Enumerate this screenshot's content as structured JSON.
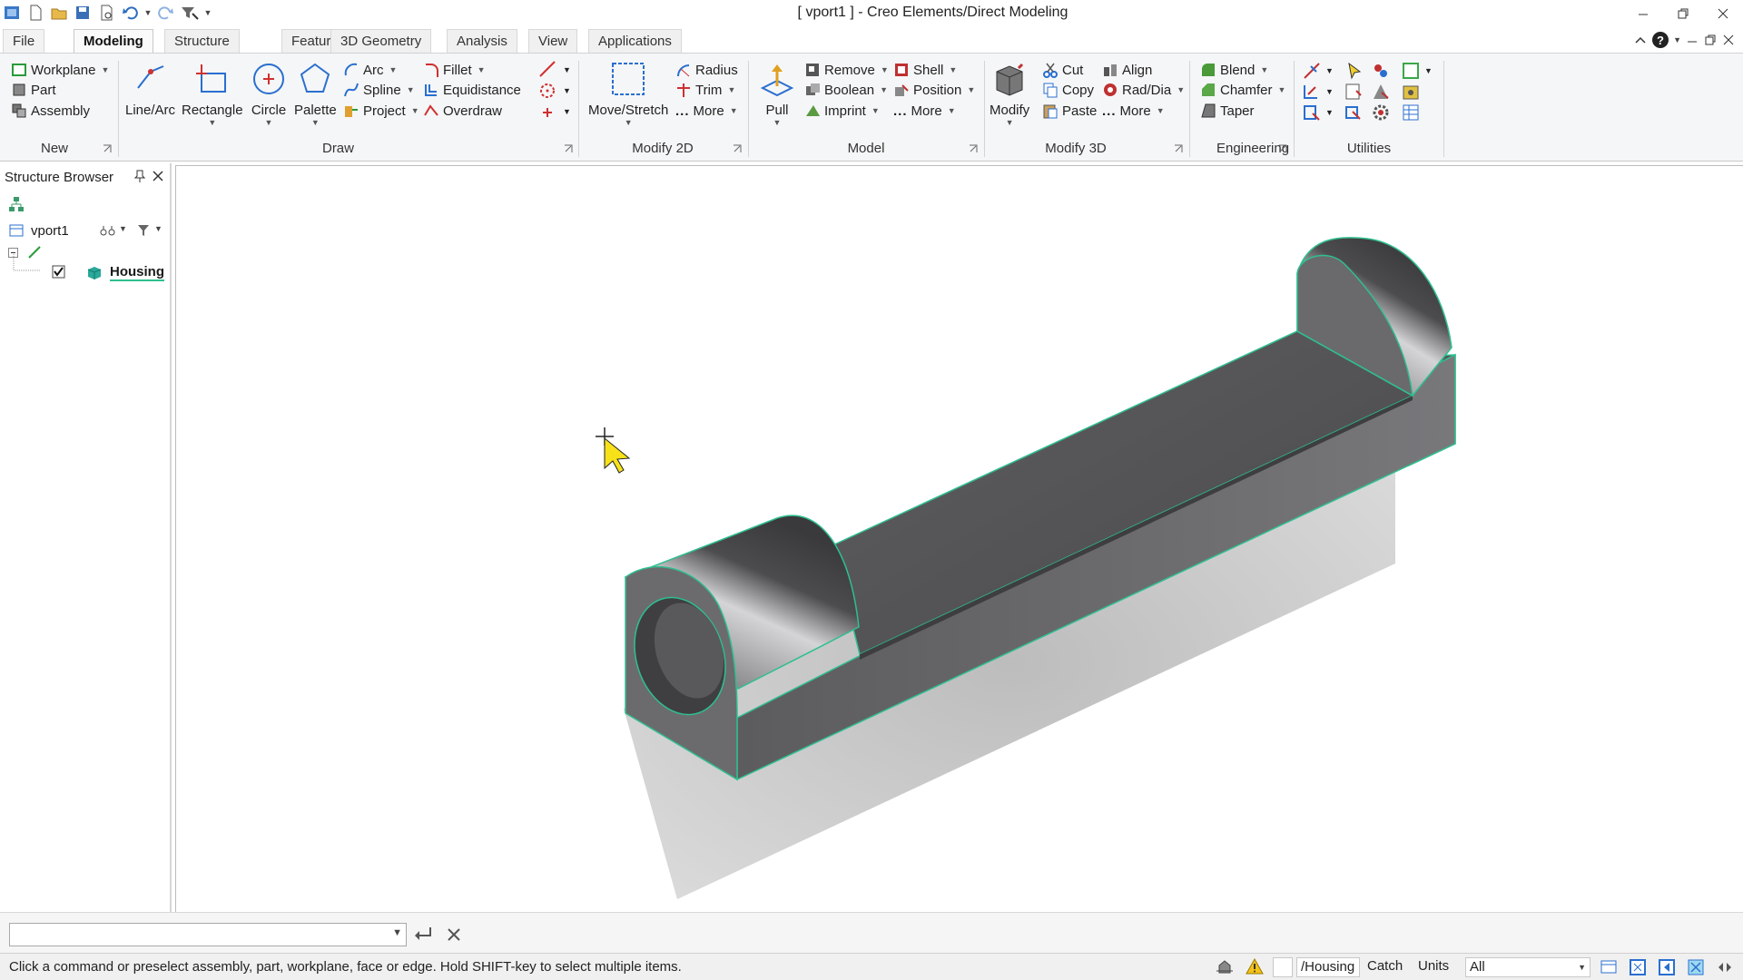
{
  "window": {
    "title": "[ vport1 ] - Creo Elements/Direct Modeling"
  },
  "ribbon_tabs": [
    "File",
    "Modeling",
    "Structure",
    "Feature",
    "3D Geometry",
    "Analysis",
    "View",
    "Applications"
  ],
  "active_tab": "Modeling",
  "groups": {
    "new": {
      "label": "New",
      "items": [
        "Workplane",
        "Part",
        "Assembly"
      ]
    },
    "draw": {
      "label": "Draw",
      "large": [
        "Line/Arc",
        "Rectangle",
        "Circle",
        "Palette"
      ],
      "small": [
        "Arc",
        "Spline",
        "Project",
        "Fillet",
        "Equidistance",
        "Overdraw"
      ]
    },
    "modify2d": {
      "label": "Modify 2D",
      "large": "Move/Stretch",
      "small": [
        "Radius",
        "Trim",
        "More"
      ]
    },
    "model": {
      "label": "Model",
      "large": "Pull",
      "small": [
        "Remove",
        "Boolean",
        "Imprint",
        "Shell",
        "Position",
        "More"
      ]
    },
    "modify3d": {
      "label": "Modify 3D",
      "large": "Modify",
      "small": [
        "Cut",
        "Copy",
        "Paste",
        "Align",
        "Rad/Dia",
        "More"
      ]
    },
    "engineering": {
      "label": "Engineering",
      "small": [
        "Blend",
        "Chamfer",
        "Taper"
      ]
    },
    "utilities": {
      "label": "Utilities"
    }
  },
  "structure_browser": {
    "title": "Structure Browser",
    "viewport": "vport1",
    "part": "Housing"
  },
  "command_line": {
    "value": ""
  },
  "status": {
    "message": "Click a command or preselect assembly, part, workplane, face or edge. Hold SHIFT-key to select multiple items.",
    "current_part": "/Housing",
    "catch_label": "Catch",
    "units_label": "Units",
    "filter_value": "All"
  },
  "colors": {
    "edge_highlight": "#2fbf8f",
    "part_dark": "#4a4a4c",
    "part_mid": "#6e6e70",
    "shadow": "#b9b9b9",
    "accent": "#2d7bd6"
  }
}
